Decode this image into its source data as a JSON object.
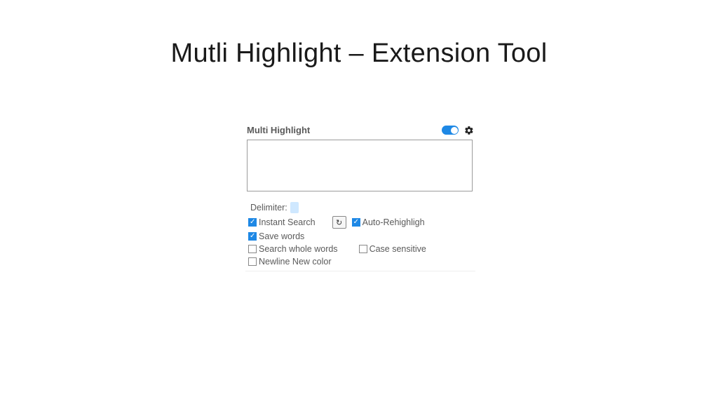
{
  "slide": {
    "title": "Mutli Highlight – Extension Tool"
  },
  "panel": {
    "title": "Multi Highlight",
    "delimiter_label": "Delimiter:",
    "options": {
      "instant_search": "Instant Search",
      "auto_rehighlight": "Auto-Rehighligh",
      "save_words": "Save words",
      "search_whole_words": "Search whole words",
      "case_sensitive": "Case sensitive",
      "newline_new_color": "Newline New color"
    }
  }
}
